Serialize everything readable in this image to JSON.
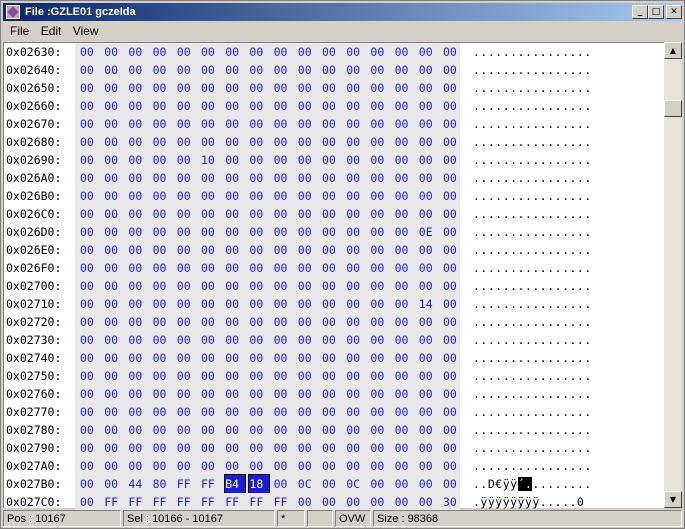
{
  "window": {
    "title": "File :GZLE01 gczelda"
  },
  "title_buttons": {
    "minimize": "_",
    "maximize": "□",
    "close": "✕"
  },
  "menu": [
    "File",
    "Edit",
    "View"
  ],
  "hex": {
    "rows": [
      {
        "addr": "0x02630:",
        "bytes": [
          "00",
          "00",
          "00",
          "00",
          "00",
          "00",
          "00",
          "00",
          "00",
          "00",
          "00",
          "00",
          "00",
          "00",
          "00",
          "00"
        ],
        "ascii": "................"
      },
      {
        "addr": "0x02640:",
        "bytes": [
          "00",
          "00",
          "00",
          "00",
          "00",
          "00",
          "00",
          "00",
          "00",
          "00",
          "00",
          "00",
          "00",
          "00",
          "00",
          "00"
        ],
        "ascii": "................"
      },
      {
        "addr": "0x02650:",
        "bytes": [
          "00",
          "00",
          "00",
          "00",
          "00",
          "00",
          "00",
          "00",
          "00",
          "00",
          "00",
          "00",
          "00",
          "00",
          "00",
          "00"
        ],
        "ascii": "................"
      },
      {
        "addr": "0x02660:",
        "bytes": [
          "00",
          "00",
          "00",
          "00",
          "00",
          "00",
          "00",
          "00",
          "00",
          "00",
          "00",
          "00",
          "00",
          "00",
          "00",
          "00"
        ],
        "ascii": "................"
      },
      {
        "addr": "0x02670:",
        "bytes": [
          "00",
          "00",
          "00",
          "00",
          "00",
          "00",
          "00",
          "00",
          "00",
          "00",
          "00",
          "00",
          "00",
          "00",
          "00",
          "00"
        ],
        "ascii": "................"
      },
      {
        "addr": "0x02680:",
        "bytes": [
          "00",
          "00",
          "00",
          "00",
          "00",
          "00",
          "00",
          "00",
          "00",
          "00",
          "00",
          "00",
          "00",
          "00",
          "00",
          "00"
        ],
        "ascii": "................"
      },
      {
        "addr": "0x02690:",
        "bytes": [
          "00",
          "00",
          "00",
          "00",
          "00",
          "10",
          "00",
          "00",
          "00",
          "00",
          "00",
          "00",
          "00",
          "00",
          "00",
          "00"
        ],
        "ascii": "................"
      },
      {
        "addr": "0x026A0:",
        "bytes": [
          "00",
          "00",
          "00",
          "00",
          "00",
          "00",
          "00",
          "00",
          "00",
          "00",
          "00",
          "00",
          "00",
          "00",
          "00",
          "00"
        ],
        "ascii": "................"
      },
      {
        "addr": "0x026B0:",
        "bytes": [
          "00",
          "00",
          "00",
          "00",
          "00",
          "00",
          "00",
          "00",
          "00",
          "00",
          "00",
          "00",
          "00",
          "00",
          "00",
          "00"
        ],
        "ascii": "................"
      },
      {
        "addr": "0x026C0:",
        "bytes": [
          "00",
          "00",
          "00",
          "00",
          "00",
          "00",
          "00",
          "00",
          "00",
          "00",
          "00",
          "00",
          "00",
          "00",
          "00",
          "00"
        ],
        "ascii": "................"
      },
      {
        "addr": "0x026D0:",
        "bytes": [
          "00",
          "00",
          "00",
          "00",
          "00",
          "00",
          "00",
          "00",
          "00",
          "00",
          "00",
          "00",
          "00",
          "00",
          "0E",
          "00"
        ],
        "ascii": "................"
      },
      {
        "addr": "0x026E0:",
        "bytes": [
          "00",
          "00",
          "00",
          "00",
          "00",
          "00",
          "00",
          "00",
          "00",
          "00",
          "00",
          "00",
          "00",
          "00",
          "00",
          "00"
        ],
        "ascii": "................"
      },
      {
        "addr": "0x026F0:",
        "bytes": [
          "00",
          "00",
          "00",
          "00",
          "00",
          "00",
          "00",
          "00",
          "00",
          "00",
          "00",
          "00",
          "00",
          "00",
          "00",
          "00"
        ],
        "ascii": "................"
      },
      {
        "addr": "0x02700:",
        "bytes": [
          "00",
          "00",
          "00",
          "00",
          "00",
          "00",
          "00",
          "00",
          "00",
          "00",
          "00",
          "00",
          "00",
          "00",
          "00",
          "00"
        ],
        "ascii": "................"
      },
      {
        "addr": "0x02710:",
        "bytes": [
          "00",
          "00",
          "00",
          "00",
          "00",
          "00",
          "00",
          "00",
          "00",
          "00",
          "00",
          "00",
          "00",
          "00",
          "14",
          "00"
        ],
        "ascii": "................"
      },
      {
        "addr": "0x02720:",
        "bytes": [
          "00",
          "00",
          "00",
          "00",
          "00",
          "00",
          "00",
          "00",
          "00",
          "00",
          "00",
          "00",
          "00",
          "00",
          "00",
          "00"
        ],
        "ascii": "................"
      },
      {
        "addr": "0x02730:",
        "bytes": [
          "00",
          "00",
          "00",
          "00",
          "00",
          "00",
          "00",
          "00",
          "00",
          "00",
          "00",
          "00",
          "00",
          "00",
          "00",
          "00"
        ],
        "ascii": "................"
      },
      {
        "addr": "0x02740:",
        "bytes": [
          "00",
          "00",
          "00",
          "00",
          "00",
          "00",
          "00",
          "00",
          "00",
          "00",
          "00",
          "00",
          "00",
          "00",
          "00",
          "00"
        ],
        "ascii": "................"
      },
      {
        "addr": "0x02750:",
        "bytes": [
          "00",
          "00",
          "00",
          "00",
          "00",
          "00",
          "00",
          "00",
          "00",
          "00",
          "00",
          "00",
          "00",
          "00",
          "00",
          "00"
        ],
        "ascii": "................"
      },
      {
        "addr": "0x02760:",
        "bytes": [
          "00",
          "00",
          "00",
          "00",
          "00",
          "00",
          "00",
          "00",
          "00",
          "00",
          "00",
          "00",
          "00",
          "00",
          "00",
          "00"
        ],
        "ascii": "................"
      },
      {
        "addr": "0x02770:",
        "bytes": [
          "00",
          "00",
          "00",
          "00",
          "00",
          "00",
          "00",
          "00",
          "00",
          "00",
          "00",
          "00",
          "00",
          "00",
          "00",
          "00"
        ],
        "ascii": "................"
      },
      {
        "addr": "0x02780:",
        "bytes": [
          "00",
          "00",
          "00",
          "00",
          "00",
          "00",
          "00",
          "00",
          "00",
          "00",
          "00",
          "00",
          "00",
          "00",
          "00",
          "00"
        ],
        "ascii": "................"
      },
      {
        "addr": "0x02790:",
        "bytes": [
          "00",
          "00",
          "00",
          "00",
          "00",
          "00",
          "00",
          "00",
          "00",
          "00",
          "00",
          "00",
          "00",
          "00",
          "00",
          "00"
        ],
        "ascii": "................"
      },
      {
        "addr": "0x027A0:",
        "bytes": [
          "00",
          "00",
          "00",
          "00",
          "00",
          "00",
          "00",
          "00",
          "00",
          "00",
          "00",
          "00",
          "00",
          "00",
          "00",
          "00"
        ],
        "ascii": "................"
      },
      {
        "addr": "0x027B0:",
        "bytes": [
          "00",
          "00",
          "44",
          "80",
          "FF",
          "FF",
          "B4",
          "18",
          "00",
          "0C",
          "00",
          "0C",
          "00",
          "00",
          "00",
          "00"
        ],
        "ascii_pre": "..D€ÿÿ",
        "ascii_sel": "´.",
        "ascii_post": "........"
      },
      {
        "addr": "0x027C0:",
        "bytes": [
          "00",
          "FF",
          "FF",
          "FF",
          "FF",
          "FF",
          "FF",
          "FF",
          "FF",
          "00",
          "00",
          "00",
          "00",
          "00",
          "00",
          "30"
        ],
        "ascii": ".ÿÿÿÿÿÿÿÿ.....0"
      }
    ],
    "selected_row": 24,
    "selected_bytes": [
      6,
      7
    ]
  },
  "scrollbar": {
    "up": "▲",
    "down": "▼"
  },
  "status": {
    "pos": "Pos : 10167",
    "sel": "Sel : 10166 - 10167",
    "modified": "*",
    "blank": "",
    "mode": "OVW",
    "size": "Size : 98368"
  },
  "colors": {
    "hex_text": "#1a1aff",
    "selection": "#1c1cd8",
    "title_start": "#0a246a",
    "title_end": "#a6caf0"
  }
}
